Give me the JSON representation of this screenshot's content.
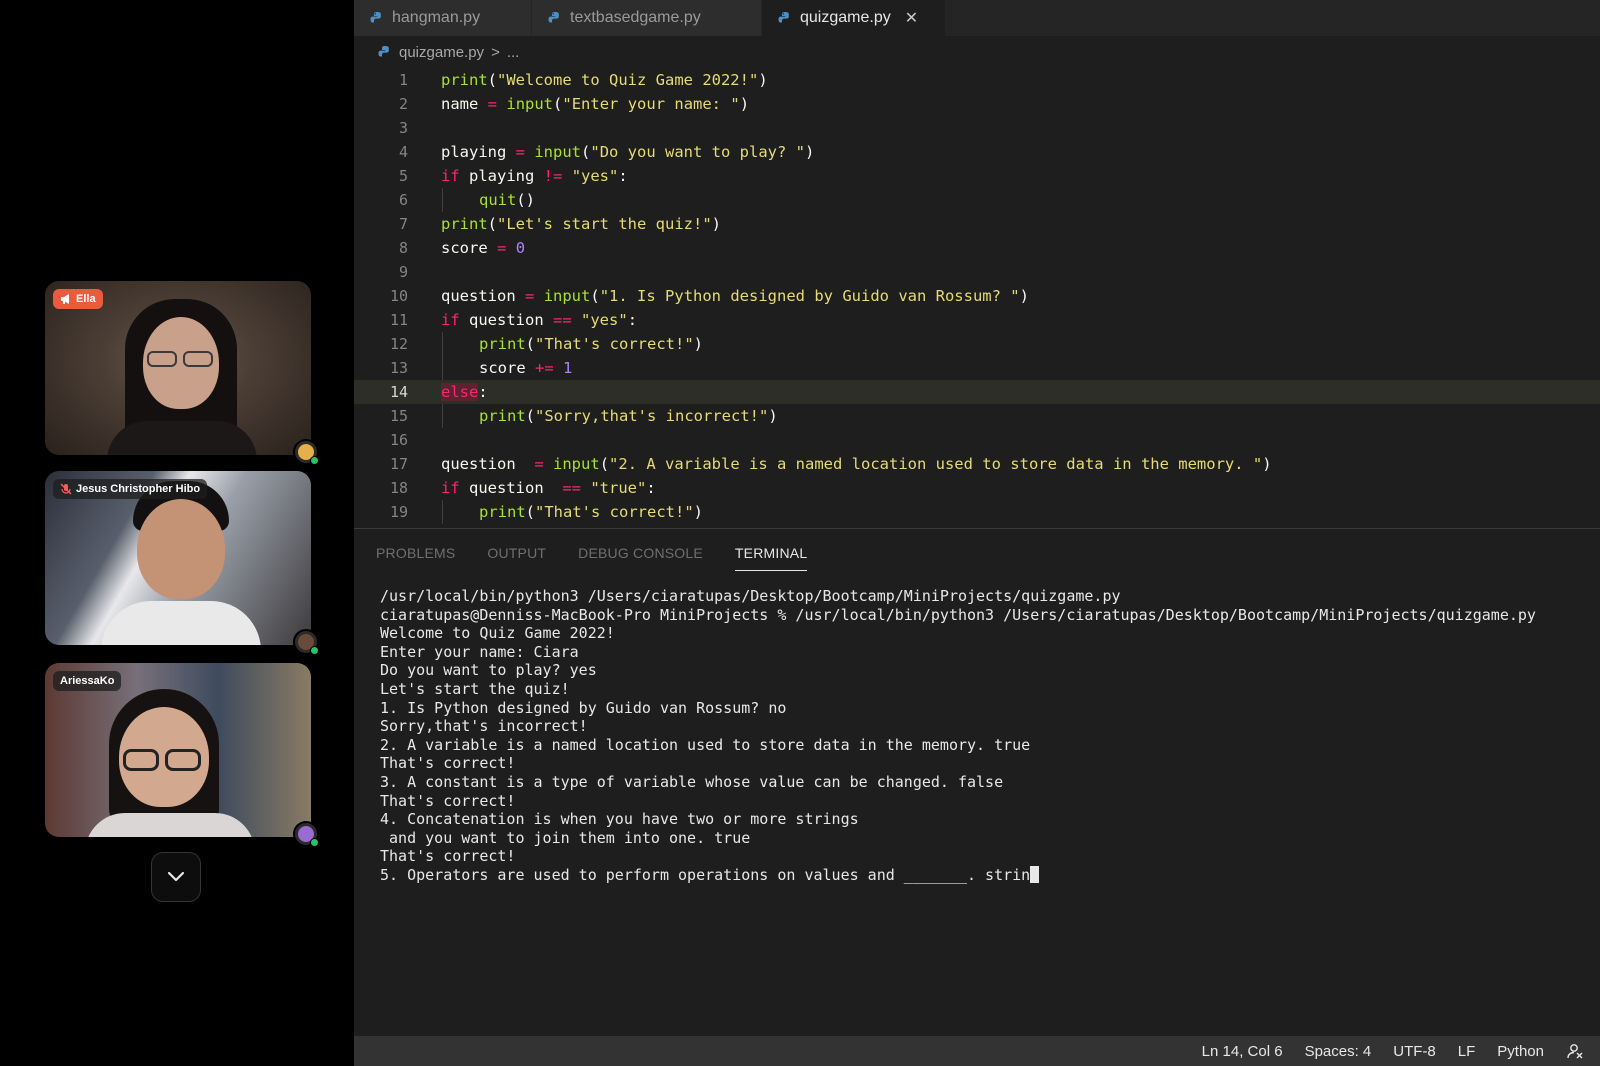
{
  "participants": [
    {
      "name": "Ella",
      "role": "host"
    },
    {
      "name": "Jesus Christopher Hibo",
      "muted": true
    },
    {
      "name": "AriessaKo"
    }
  ],
  "editor": {
    "tabs": [
      {
        "label": "hangman.py",
        "active": false
      },
      {
        "label": "textbasedgame.py",
        "active": false
      },
      {
        "label": "quizgame.py",
        "active": true
      }
    ],
    "breadcrumb": {
      "file": "quizgame.py",
      "separator": ">",
      "rest": "..."
    },
    "current_line": 14,
    "code_lines": [
      {
        "n": "1",
        "indent": 0,
        "tokens": [
          [
            "fn",
            "print"
          ],
          [
            "punc",
            "("
          ],
          [
            "str",
            "\"Welcome to Quiz Game 2022!\""
          ],
          [
            "punc",
            ")"
          ]
        ]
      },
      {
        "n": "2",
        "indent": 0,
        "tokens": [
          [
            "var",
            "name "
          ],
          [
            "op",
            "="
          ],
          [
            "var",
            " "
          ],
          [
            "fn",
            "input"
          ],
          [
            "punc",
            "("
          ],
          [
            "str",
            "\"Enter your name: \""
          ],
          [
            "punc",
            ")"
          ]
        ]
      },
      {
        "n": "3",
        "indent": 0,
        "tokens": []
      },
      {
        "n": "4",
        "indent": 0,
        "tokens": [
          [
            "var",
            "playing "
          ],
          [
            "op",
            "="
          ],
          [
            "var",
            " "
          ],
          [
            "fn",
            "input"
          ],
          [
            "punc",
            "("
          ],
          [
            "str",
            "\"Do you want to play? \""
          ],
          [
            "punc",
            ")"
          ]
        ]
      },
      {
        "n": "5",
        "indent": 0,
        "tokens": [
          [
            "kw",
            "if"
          ],
          [
            "var",
            " playing "
          ],
          [
            "op",
            "!="
          ],
          [
            "var",
            " "
          ],
          [
            "str",
            "\"yes\""
          ],
          [
            "punc",
            ":"
          ]
        ]
      },
      {
        "n": "6",
        "indent": 1,
        "tokens": [
          [
            "fn",
            "quit"
          ],
          [
            "punc",
            "()"
          ]
        ]
      },
      {
        "n": "7",
        "indent": 0,
        "tokens": [
          [
            "fn",
            "print"
          ],
          [
            "punc",
            "("
          ],
          [
            "str",
            "\"Let's start the quiz!\""
          ],
          [
            "punc",
            ")"
          ]
        ]
      },
      {
        "n": "8",
        "indent": 0,
        "tokens": [
          [
            "var",
            "score "
          ],
          [
            "op",
            "="
          ],
          [
            "var",
            " "
          ],
          [
            "num",
            "0"
          ]
        ]
      },
      {
        "n": "9",
        "indent": 0,
        "tokens": []
      },
      {
        "n": "10",
        "indent": 0,
        "tokens": [
          [
            "var",
            "question "
          ],
          [
            "op",
            "="
          ],
          [
            "var",
            " "
          ],
          [
            "fn",
            "input"
          ],
          [
            "punc",
            "("
          ],
          [
            "str",
            "\"1. Is Python designed by Guido van Rossum? \""
          ],
          [
            "punc",
            ")"
          ]
        ]
      },
      {
        "n": "11",
        "indent": 0,
        "tokens": [
          [
            "kw",
            "if"
          ],
          [
            "var",
            " question "
          ],
          [
            "op",
            "=="
          ],
          [
            "var",
            " "
          ],
          [
            "str",
            "\"yes\""
          ],
          [
            "punc",
            ":"
          ]
        ]
      },
      {
        "n": "12",
        "indent": 1,
        "tokens": [
          [
            "fn",
            "print"
          ],
          [
            "punc",
            "("
          ],
          [
            "str",
            "\"That's correct!\""
          ],
          [
            "punc",
            ")"
          ]
        ]
      },
      {
        "n": "13",
        "indent": 1,
        "tokens": [
          [
            "var",
            "score "
          ],
          [
            "op",
            "+="
          ],
          [
            "var",
            " "
          ],
          [
            "num",
            "1"
          ]
        ]
      },
      {
        "n": "14",
        "indent": 0,
        "tokens": [
          [
            "else",
            "else"
          ],
          [
            "punc",
            ":"
          ]
        ]
      },
      {
        "n": "15",
        "indent": 1,
        "tokens": [
          [
            "fn",
            "print"
          ],
          [
            "punc",
            "("
          ],
          [
            "str",
            "\"Sorry,that's incorrect!\""
          ],
          [
            "punc",
            ")"
          ]
        ]
      },
      {
        "n": "16",
        "indent": 0,
        "tokens": []
      },
      {
        "n": "17",
        "indent": 0,
        "tokens": [
          [
            "var",
            "question  "
          ],
          [
            "op",
            "="
          ],
          [
            "var",
            " "
          ],
          [
            "fn",
            "input"
          ],
          [
            "punc",
            "("
          ],
          [
            "str",
            "\"2. A variable is a named location used to store data in the memory. \""
          ],
          [
            "punc",
            ")"
          ]
        ]
      },
      {
        "n": "18",
        "indent": 0,
        "tokens": [
          [
            "kw",
            "if"
          ],
          [
            "var",
            " question  "
          ],
          [
            "op",
            "=="
          ],
          [
            "var",
            " "
          ],
          [
            "str",
            "\"true\""
          ],
          [
            "punc",
            ":"
          ]
        ]
      },
      {
        "n": "19",
        "indent": 1,
        "tokens": [
          [
            "fn",
            "print"
          ],
          [
            "punc",
            "("
          ],
          [
            "str",
            "\"That's correct!\""
          ],
          [
            "punc",
            ")"
          ]
        ]
      }
    ]
  },
  "panel": {
    "tabs": [
      {
        "label": "PROBLEMS",
        "active": false
      },
      {
        "label": "OUTPUT",
        "active": false
      },
      {
        "label": "DEBUG CONSOLE",
        "active": false
      },
      {
        "label": "TERMINAL",
        "active": true
      }
    ],
    "terminal_lines": [
      "/usr/local/bin/python3 /Users/ciaratupas/Desktop/Bootcamp/MiniProjects/quizgame.py",
      "ciaratupas@Denniss-MacBook-Pro MiniProjects % /usr/local/bin/python3 /Users/ciaratupas/Desktop/Bootcamp/MiniProjects/quizgame.py",
      "Welcome to Quiz Game 2022!",
      "Enter your name: Ciara",
      "Do you want to play? yes",
      "Let's start the quiz!",
      "1. Is Python designed by Guido van Rossum? no",
      "Sorry,that's incorrect!",
      "2. A variable is a named location used to store data in the memory. true",
      "That's correct!",
      "3. A constant is a type of variable whose value can be changed. false",
      "That's correct!",
      "4. Concatenation is when you have two or more strings",
      " and you want to join them into one. true",
      "That's correct!"
    ],
    "terminal_input_line": "5. Operators are used to perform operations on values and _______. strin"
  },
  "status_bar": {
    "position": "Ln 14, Col 6",
    "spaces": "Spaces: 4",
    "encoding": "UTF-8",
    "eol": "LF",
    "language": "Python"
  },
  "colors": {
    "accent_host": "#ea5a3c",
    "online": "#27c46a",
    "fn": "#a6e22e",
    "string": "#e6db74",
    "keyword": "#f92672",
    "number": "#ae81ff"
  }
}
